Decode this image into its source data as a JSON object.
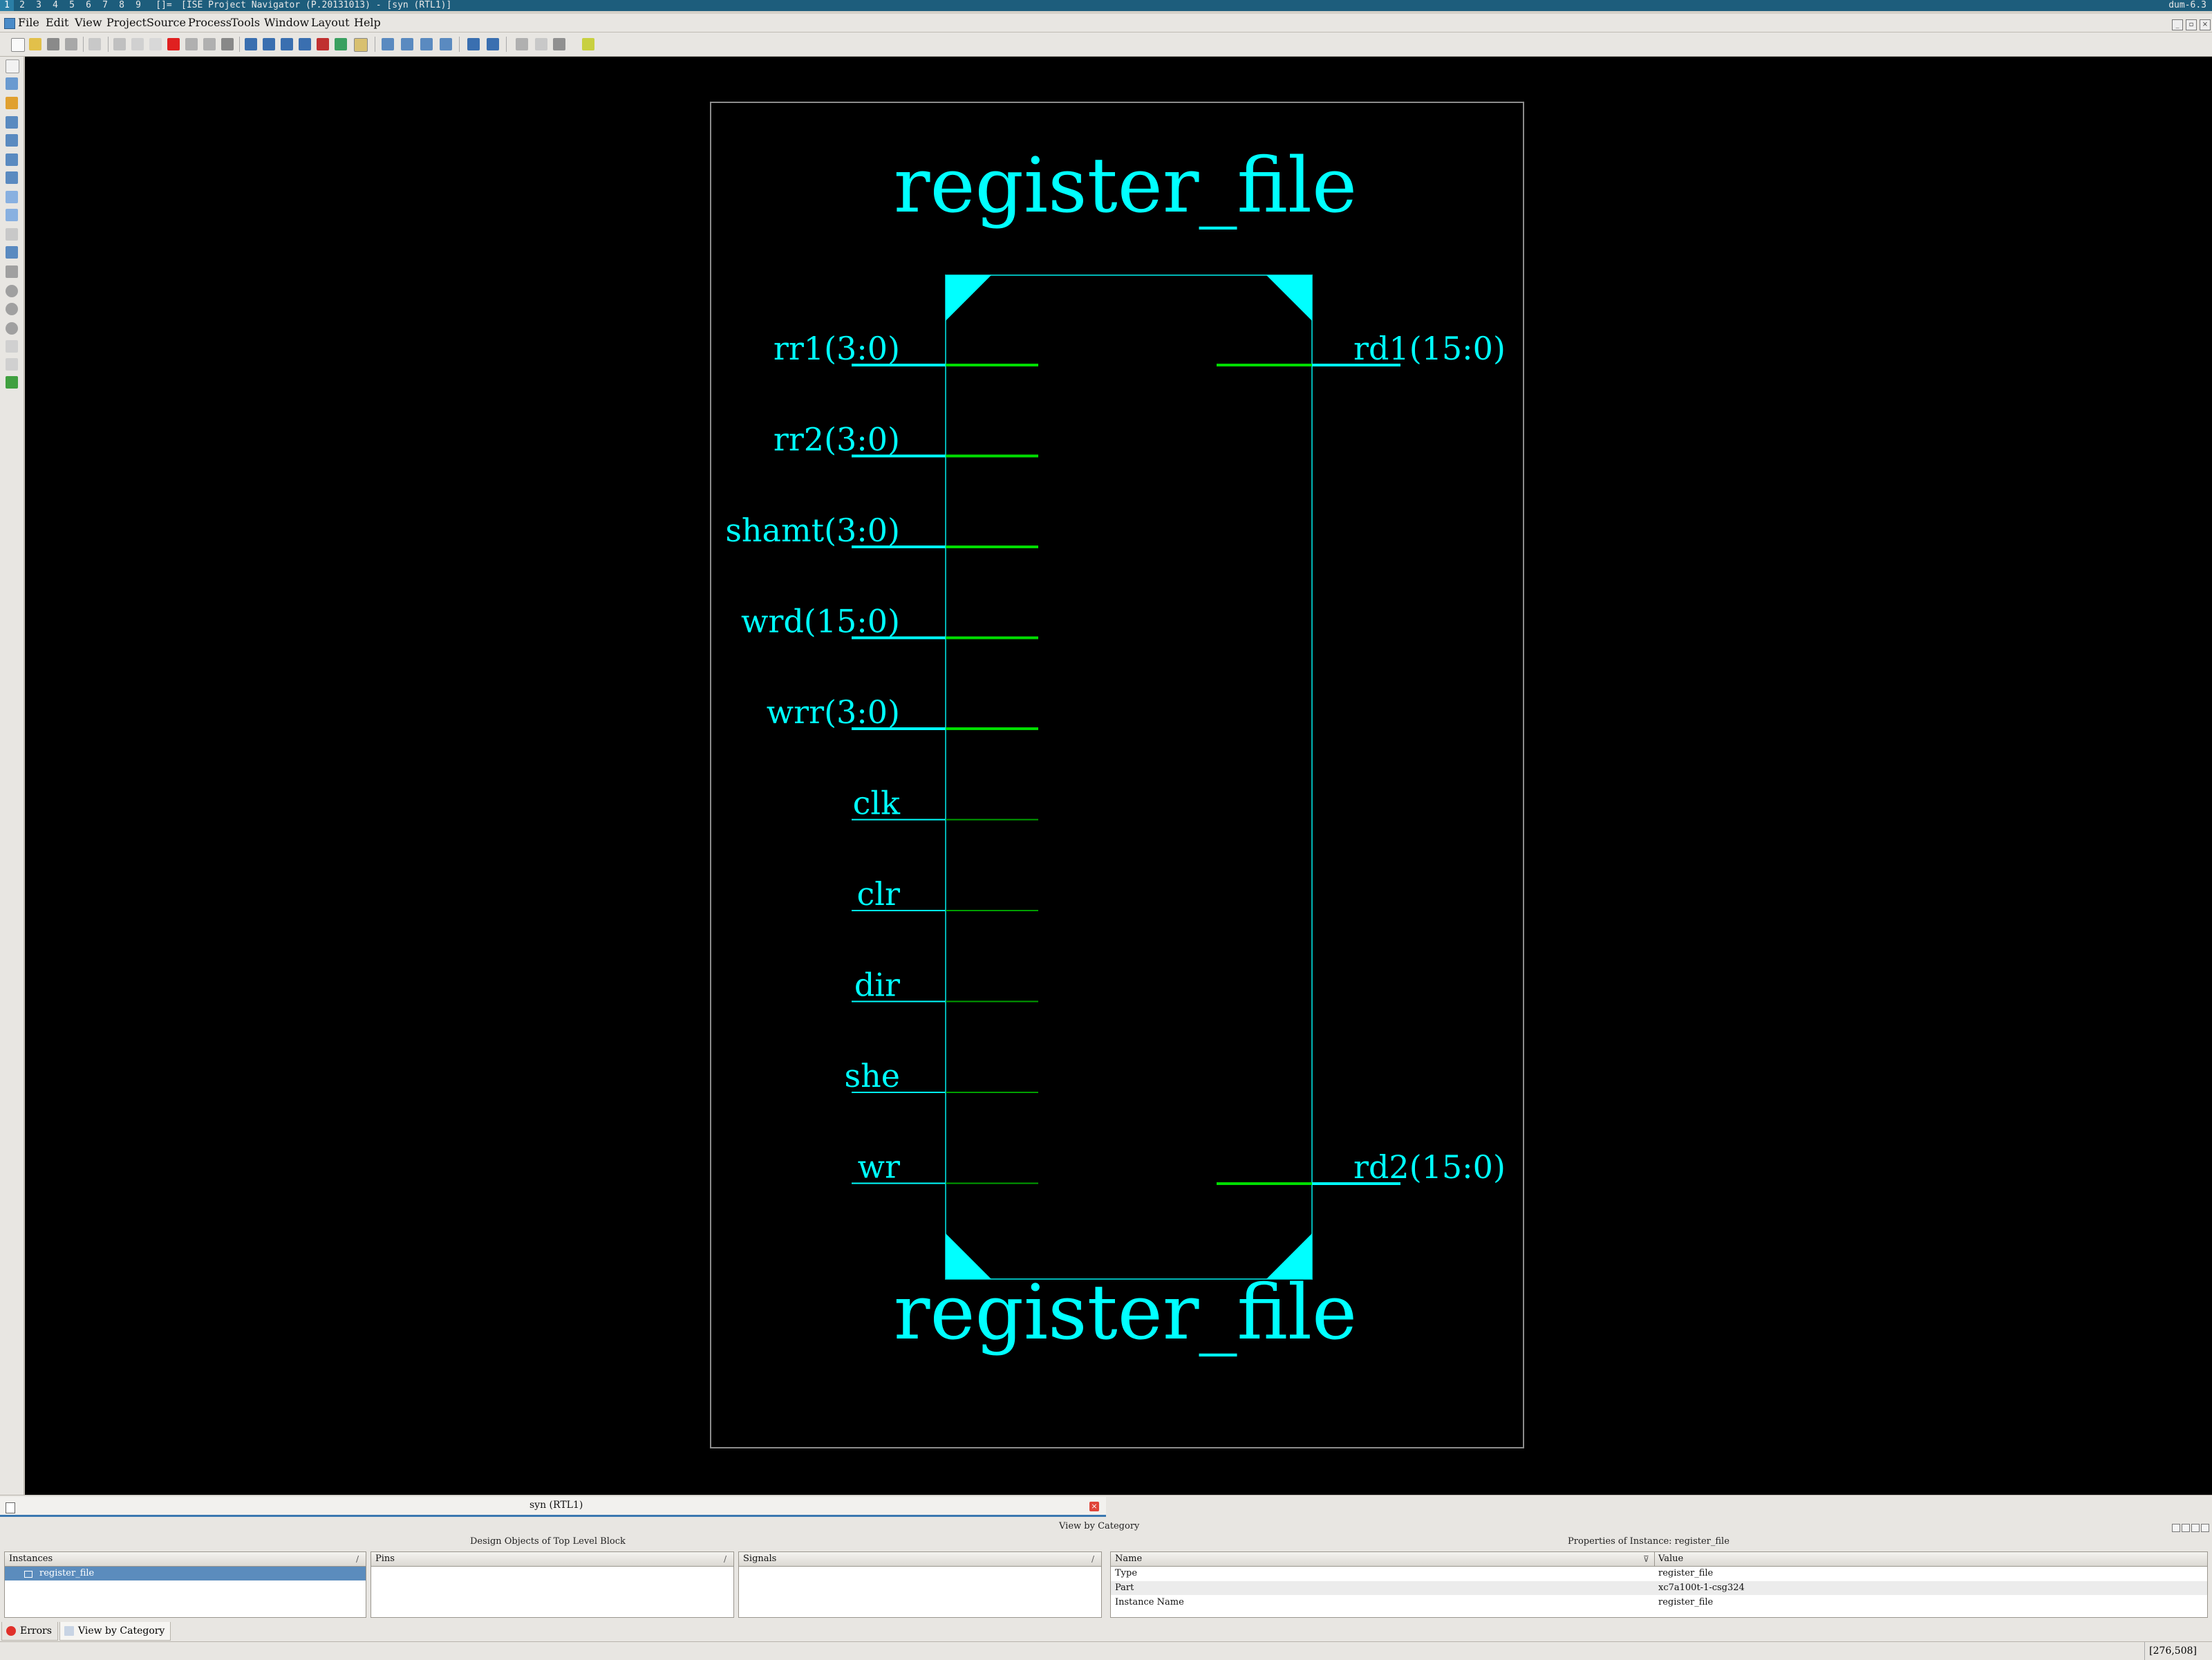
{
  "titlebar": {
    "workspaces": [
      "1",
      "2",
      "3",
      "4",
      "5",
      "6",
      "7",
      "8",
      "9",
      "[]="
    ],
    "title": "[ISE Project Navigator (P.20131013) - [syn (RTL1)]",
    "right": "dum-6.3"
  },
  "menu": [
    "File",
    "Edit",
    "View",
    "Project",
    "Source",
    "Process",
    "Tools",
    "Window",
    "Layout",
    "Help"
  ],
  "schematic": {
    "title_top": "register_file",
    "title_bottom": "register_file",
    "inputs": [
      {
        "label": "rr1(3:0)",
        "bus": true
      },
      {
        "label": "rr2(3:0)",
        "bus": true
      },
      {
        "label": "shamt(3:0)",
        "bus": true
      },
      {
        "label": "wrd(15:0)",
        "bus": true
      },
      {
        "label": "wrr(3:0)",
        "bus": true
      },
      {
        "label": "clk",
        "bus": false
      },
      {
        "label": "clr",
        "bus": false
      },
      {
        "label": "dir",
        "bus": false
      },
      {
        "label": "she",
        "bus": false
      },
      {
        "label": "wr",
        "bus": false
      }
    ],
    "outputs": [
      {
        "label": "rd1(15:0)",
        "bus": true
      },
      {
        "label": "rd2(15:0)",
        "bus": true
      }
    ],
    "colors": {
      "text": "#00ffff",
      "box": "#00b4b4",
      "pin": "#00ffff",
      "wire": "#00dd00",
      "frame": "#8c8c8c",
      "background": "#000000"
    }
  },
  "doc_tab": {
    "label": "syn (RTL1)",
    "close_icon": "close-icon"
  },
  "bottom_panel": {
    "view_title": "View by Category",
    "design_objects_title": "Design Objects of Top Level Block",
    "properties_title": "Properties of Instance: register_file",
    "instances": {
      "header": "Instances",
      "items": [
        "register_file"
      ]
    },
    "pins": {
      "header": "Pins",
      "items": []
    },
    "signals": {
      "header": "Signals",
      "items": []
    },
    "properties": {
      "name_header": "Name",
      "value_header": "Value",
      "rows": [
        {
          "name": "Type",
          "value": "register_file"
        },
        {
          "name": "Part",
          "value": "xc7a100t-1-csg324"
        },
        {
          "name": "Instance Name",
          "value": "register_file"
        }
      ]
    }
  },
  "bottom_tabs": [
    "Errors",
    "View by Category"
  ],
  "status": {
    "coords": "[276,508]"
  }
}
